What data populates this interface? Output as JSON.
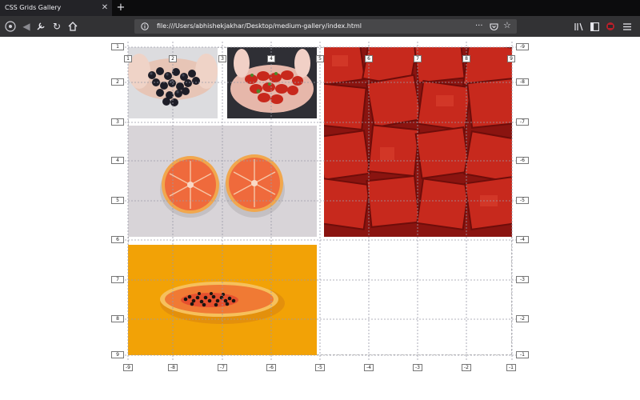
{
  "browser": {
    "tab_title": "CSS Grids Gallery",
    "tab_close": "✕",
    "new_tab": "+",
    "url": "file:///Users/abhishekjakhar/Desktop/medium-gallery/index.html",
    "page_actions": "···",
    "icons": [
      "menu-icon",
      "back-icon",
      "forward-icon",
      "customize-icon",
      "reload-icon",
      "home-icon",
      "info-icon",
      "pocket-icon",
      "bookmark-star-icon",
      "library-icon",
      "sidebar-icon",
      "extension-icon",
      "hamburger-menu-icon"
    ]
  },
  "gallery": {
    "images": [
      {
        "name": "blueberries"
      },
      {
        "name": "strawberries"
      },
      {
        "name": "watermelon"
      },
      {
        "name": "grapefruit"
      },
      {
        "name": "papaya"
      }
    ]
  },
  "grid_overlay": {
    "top_labels": [
      "1",
      "2",
      "3",
      "4",
      "5",
      "6",
      "7",
      "8",
      "9"
    ],
    "bottom_labels": [
      "-9",
      "-8",
      "-7",
      "-6",
      "-5",
      "-4",
      "-3",
      "-2",
      "-1"
    ],
    "left_labels": [
      "1",
      "2",
      "3",
      "4",
      "5",
      "6",
      "7",
      "8",
      "9"
    ],
    "right_labels": [
      "-9",
      "-8",
      "-7",
      "-6",
      "-5",
      "-4",
      "-3",
      "-2",
      "-1"
    ]
  },
  "colors": {
    "tabbar": "#0c0c0d",
    "toolbar": "#323234",
    "grid_line": "#9a9aa8",
    "watermelon": "#c2281c",
    "papaya_bg": "#f2a206"
  }
}
